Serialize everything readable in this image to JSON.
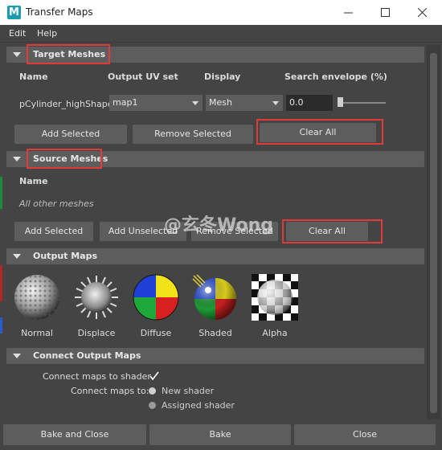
{
  "window": {
    "title": "Transfer Maps",
    "app_icon_letter": "M"
  },
  "menu": {
    "items": [
      "Edit",
      "Help"
    ]
  },
  "target_meshes": {
    "header": "Target Meshes",
    "columns": [
      "Name",
      "Output UV set",
      "Display",
      "Search envelope (%)"
    ],
    "row": {
      "name": "pCylinder_highShape",
      "uv_set": "map1",
      "display": "Mesh",
      "envelope": "0.0",
      "envelope_slider_value": 0
    },
    "buttons": {
      "add_selected": "Add Selected",
      "remove_selected": "Remove Selected",
      "clear_all": "Clear All"
    }
  },
  "source_meshes": {
    "header": "Source Meshes",
    "column_name": "Name",
    "placeholder_row": "All other meshes",
    "buttons": {
      "add_selected": "Add Selected",
      "add_unselected": "Add Unselected",
      "remove_selected": "Remove Selected",
      "clear_all": "Clear All"
    }
  },
  "watermark": "@玄冬Wong",
  "output_maps": {
    "header": "Output Maps",
    "maps": [
      {
        "label": "Normal",
        "icon": "normal-map-icon"
      },
      {
        "label": "Displace",
        "icon": "displace-map-icon"
      },
      {
        "label": "Diffuse",
        "icon": "diffuse-map-icon"
      },
      {
        "label": "Shaded",
        "icon": "shaded-map-icon"
      },
      {
        "label": "Alpha",
        "icon": "alpha-map-icon"
      }
    ]
  },
  "connect_output_maps": {
    "header": "Connect Output Maps",
    "connect_to_shader_label": "Connect maps to shader",
    "connect_to_shader_checked": true,
    "connect_maps_to_label": "Connect maps to:",
    "options": [
      "New shader",
      "Assigned shader"
    ]
  },
  "footer": {
    "bake_and_close": "Bake and Close",
    "bake": "Bake",
    "close": "Close"
  },
  "colors": {
    "highlight_box": "#e13a3a",
    "panel_bg": "#444444",
    "header_bg": "#5d5d5d",
    "field_bg": "#2b2b2b"
  }
}
